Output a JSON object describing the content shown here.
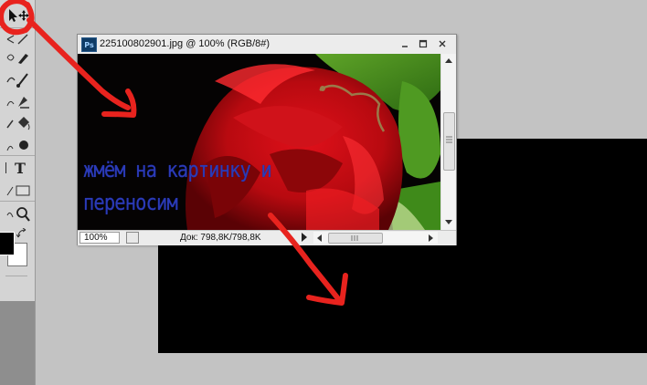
{
  "app": {
    "name": "Photoshop",
    "icon_label": "Ps"
  },
  "toolbox": {
    "tools": [
      {
        "name": "move-tool",
        "icon": "move-icon"
      },
      {
        "name": "lasso-tool",
        "icon": "lasso-icon"
      },
      {
        "name": "brush-tool",
        "icon": "brush-icon"
      },
      {
        "name": "clone-stamp-tool",
        "icon": "stamp-icon"
      },
      {
        "name": "paint-bucket-tool",
        "icon": "bucket-icon"
      },
      {
        "name": "burn-tool",
        "icon": "burn-icon"
      },
      {
        "name": "type-tool",
        "icon": "type-icon",
        "glyph": "T"
      },
      {
        "name": "shape-tool",
        "icon": "rectangle-icon"
      },
      {
        "name": "zoom-tool",
        "icon": "zoom-icon"
      }
    ],
    "foreground_color": "#000000",
    "background_color": "#ffffff"
  },
  "document": {
    "title": "225100802901.jpg @ 100% (RGB/8#)",
    "zoom": "100%",
    "doc_info": "Док: 798,8K/798,8K"
  },
  "overlay": {
    "caption_line1": "жмём на картинку и",
    "caption_line2": "переносим",
    "marker_color": "#e8231e",
    "caption_color": "#2b3bb8"
  }
}
